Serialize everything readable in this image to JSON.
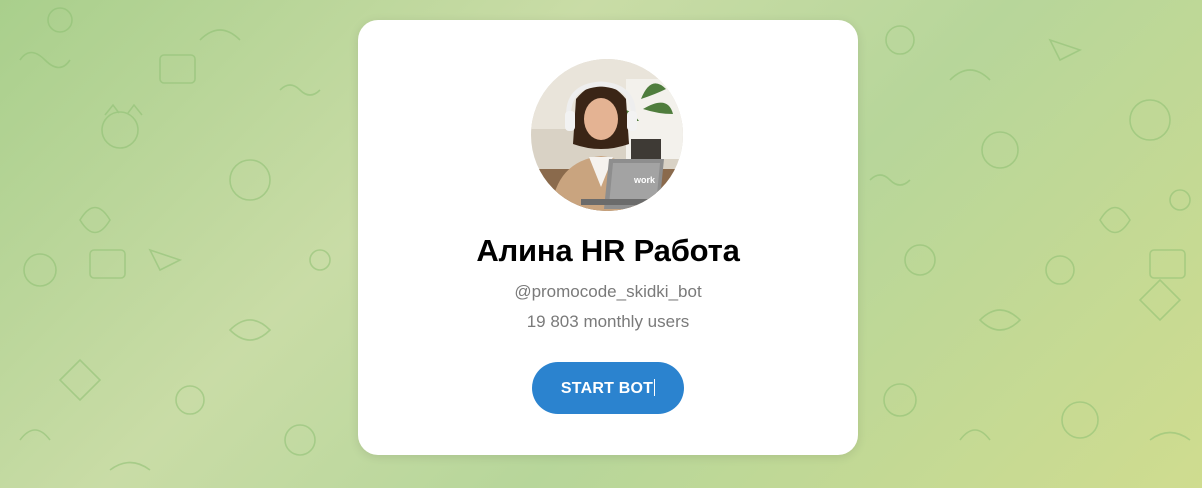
{
  "bot": {
    "name": "Алина HR Работа",
    "username": "@promocode_skidki_bot",
    "monthly_users": "19 803 monthly users",
    "avatar_laptop_text": "work"
  },
  "actions": {
    "start_label": "START BOT"
  },
  "colors": {
    "button": "#2b83cf",
    "background": "#b7d69a",
    "card": "#ffffff"
  },
  "icons": {
    "background": "doodle-pattern"
  }
}
